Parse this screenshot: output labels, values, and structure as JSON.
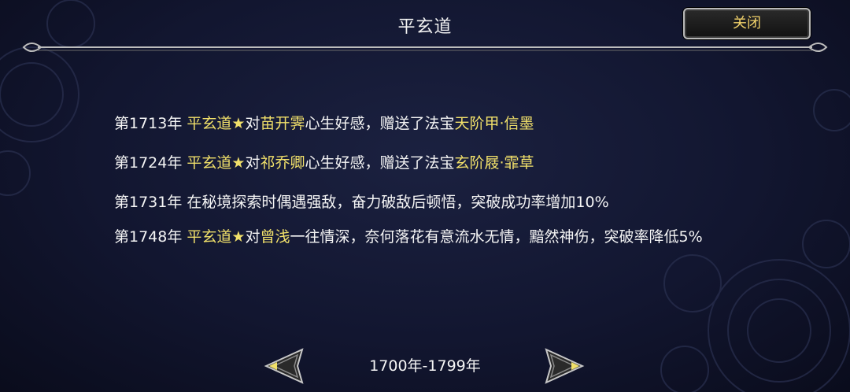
{
  "header": {
    "title": "平玄道",
    "close_label": "关闭"
  },
  "log": [
    {
      "year": "第1713年",
      "parts": [
        {
          "text": "平玄道★",
          "hl": true
        },
        {
          "text": "对",
          "hl": false
        },
        {
          "text": "苗开霁",
          "hl": true
        },
        {
          "text": "心生好感，赠送了法宝",
          "hl": false
        },
        {
          "text": "天阶甲·信墨",
          "hl": true
        }
      ]
    },
    {
      "year": "第1724年",
      "parts": [
        {
          "text": "平玄道★",
          "hl": true
        },
        {
          "text": "对",
          "hl": false
        },
        {
          "text": "祁乔卿",
          "hl": true
        },
        {
          "text": "心生好感，赠送了法宝",
          "hl": false
        },
        {
          "text": "玄阶屐·霏草",
          "hl": true
        }
      ]
    },
    {
      "year": "第1731年",
      "parts": [
        {
          "text": "在秘境探索时偶遇强敌，奋力破敌后顿悟，突破成功率增加10%",
          "hl": false
        }
      ]
    },
    {
      "year": "第1748年",
      "parts": [
        {
          "text": "平玄道★",
          "hl": true
        },
        {
          "text": "对",
          "hl": false
        },
        {
          "text": "曾浅",
          "hl": true
        },
        {
          "text": "一往情深，奈何落花有意流水无情，黯然神伤，突破率降低5%",
          "hl": false
        }
      ]
    }
  ],
  "pager": {
    "range": "1700年-1799年",
    "prev_icon": "left-arrow-icon",
    "next_icon": "right-arrow-icon"
  },
  "colors": {
    "highlight": "#f1e06a",
    "close_text": "#f3d36b",
    "background": "#161a34"
  }
}
